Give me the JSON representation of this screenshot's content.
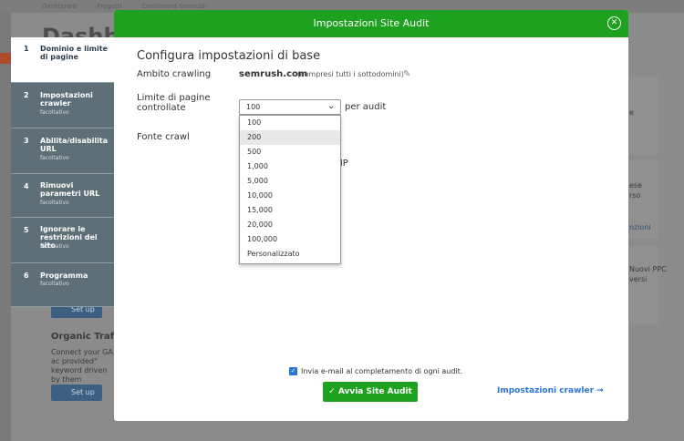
{
  "background": {
    "breadcrumb": [
      "Dashboard",
      "Progetti",
      "Dashboard Semrush"
    ],
    "page_title": "Dashbo",
    "cards": [
      {
        "text": "e",
        "link": ""
      },
      {
        "text": "ese\nrso",
        "link": "nzioni"
      },
      {
        "text": "Nuovi PPC\nversi",
        "link": ""
      }
    ],
    "setup_label": "Set up",
    "organic_title": "Organic Traffic",
    "organic_text": "Connect your GA ac provided\" keyword driven by them"
  },
  "steps": [
    {
      "num": "1",
      "title": "Dominio e limite di pagine",
      "sub": "",
      "active": true
    },
    {
      "num": "2",
      "title": "Impostazioni crawler",
      "sub": "facoltativo",
      "active": false
    },
    {
      "num": "3",
      "title": "Abilita/disabilita URL",
      "sub": "facoltativo",
      "active": false
    },
    {
      "num": "4",
      "title": "Rimuovi parametri URL",
      "sub": "facoltativo",
      "active": false
    },
    {
      "num": "5",
      "title": "Ignorare le restrizioni del sito",
      "sub": "facoltativo",
      "active": false
    },
    {
      "num": "6",
      "title": "Programma",
      "sub": "facoltativo",
      "active": false
    }
  ],
  "modal": {
    "title": "Impostazioni Site Audit",
    "section_title": "Configura impostazioni di base",
    "crawl_scope_label": "Ambito crawling",
    "domain": "semrush.com",
    "domain_note": "(compresi tutti i sottodomini)",
    "page_limit_label": "Limite di pagine controllate",
    "page_limit_value": "100",
    "per_audit": "per audit",
    "crawl_source_label": "Fonte crawl",
    "amp_fragment": "e AMP",
    "dropdown_options": [
      "100",
      "200",
      "500",
      "1,000",
      "5,000",
      "10,000",
      "15,000",
      "20,000",
      "100,000",
      "Personalizzato"
    ],
    "highlighted_option": "200",
    "email_label": "Invia e-mail al completamento di ogni audit.",
    "start_button": "Avvia Site Audit",
    "crawler_link": "Impostazioni crawler →"
  },
  "colors": {
    "green": "#1ea11e",
    "blue": "#2a74d6",
    "step_bg": "#5e6f78"
  }
}
